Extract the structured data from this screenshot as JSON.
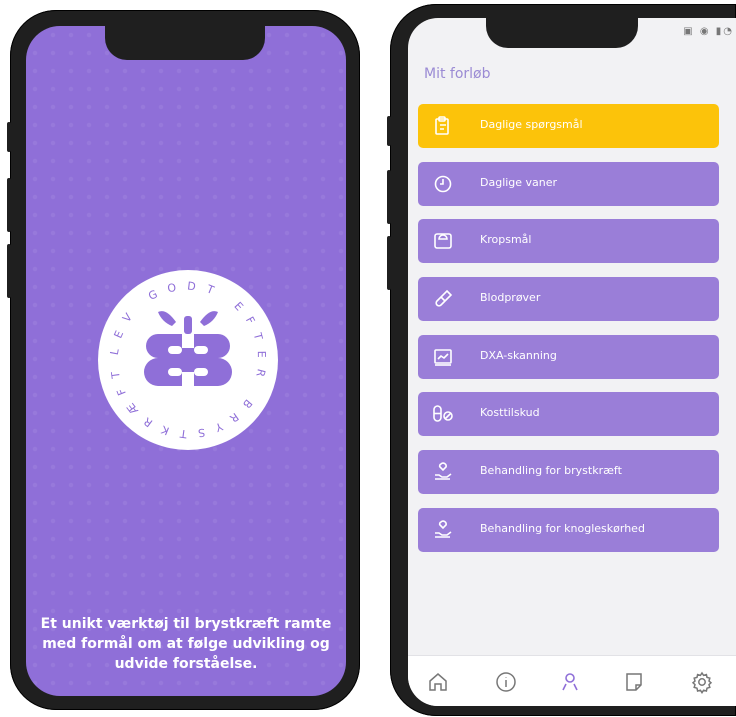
{
  "splash": {
    "badge_text": "LEV GODT EFTER BRYSTKRÆFT",
    "tagline_lines": [
      "Et unikt værktøj til brystkræft ramte",
      "med formål om at følge udvikling og",
      "udvide forståelse."
    ],
    "colors": {
      "background": "#8f6fd8",
      "badge": "#ffffff"
    }
  },
  "course": {
    "title": "Mit forløb",
    "items": [
      {
        "label": "Daglige spørgsmål",
        "icon": "clipboard-icon",
        "active": true
      },
      {
        "label": "Daglige vaner",
        "icon": "clock-icon"
      },
      {
        "label": "Kropsmål",
        "icon": "scale-icon"
      },
      {
        "label": "Blodprøver",
        "icon": "test-tube-icon"
      },
      {
        "label": "DXA-skanning",
        "icon": "scan-chart-icon"
      },
      {
        "label": "Kosttilskud",
        "icon": "supplement-icon"
      },
      {
        "label": "Behandling for brystkræft",
        "icon": "care-hand-icon"
      },
      {
        "label": "Behandling for knogleskørhed",
        "icon": "care-hand-icon"
      }
    ],
    "tabs": [
      {
        "name": "home",
        "icon": "home-icon"
      },
      {
        "name": "info",
        "icon": "info-icon"
      },
      {
        "name": "profile",
        "icon": "person-icon",
        "active": true
      },
      {
        "name": "notes",
        "icon": "note-icon"
      },
      {
        "name": "settings",
        "icon": "gear-icon"
      }
    ],
    "colors": {
      "item": "#9a7ed8",
      "active_item": "#fcc30a",
      "title": "#9b8bd4",
      "active_tab": "#8f6fd8"
    }
  }
}
